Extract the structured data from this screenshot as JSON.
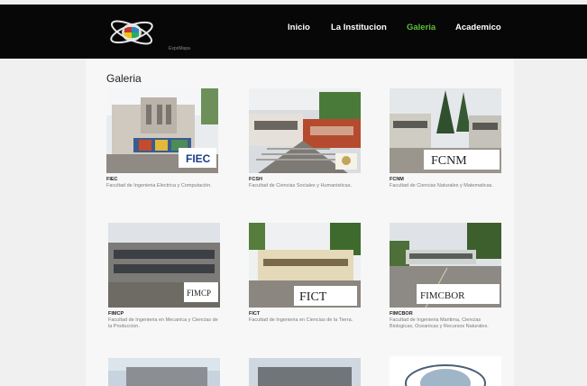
{
  "header": {
    "logo_text": "ExpoMapa",
    "nav": [
      {
        "label": "Inicio",
        "active": false
      },
      {
        "label": "La Institucion",
        "active": false
      },
      {
        "label": "Galeria",
        "active": true
      },
      {
        "label": "Academico",
        "active": false
      }
    ],
    "active_color": "#5fbf3a"
  },
  "page": {
    "title": "Galeria"
  },
  "gallery": [
    {
      "title": "FIEC",
      "desc": "Facultad de Ingenieria Electrica y Computación.",
      "sign": "FIEC"
    },
    {
      "title": "FCSH",
      "desc": "Facultad de Ciencias Sociales y Humanisticas.",
      "sign": ""
    },
    {
      "title": "FCNM",
      "desc": "Facultad de Ciencias Naturales y Matematicas.",
      "sign": "FCNM"
    },
    {
      "title": "FIMCP",
      "desc": "Facultad de Ingenieria en Mecanica y Ciencias de la Produccion.",
      "sign": "FIMCP"
    },
    {
      "title": "FICT",
      "desc": "Facultad de Ingenieria en Ciencias de la Tierra.",
      "sign": "FICT"
    },
    {
      "title": "FIMCBOR",
      "desc": "Facultad de Ingenieria Maritima, Ciencias Biologicas, Oceanicas y Recursos Naturales.",
      "sign": "FIMCBOR"
    }
  ]
}
